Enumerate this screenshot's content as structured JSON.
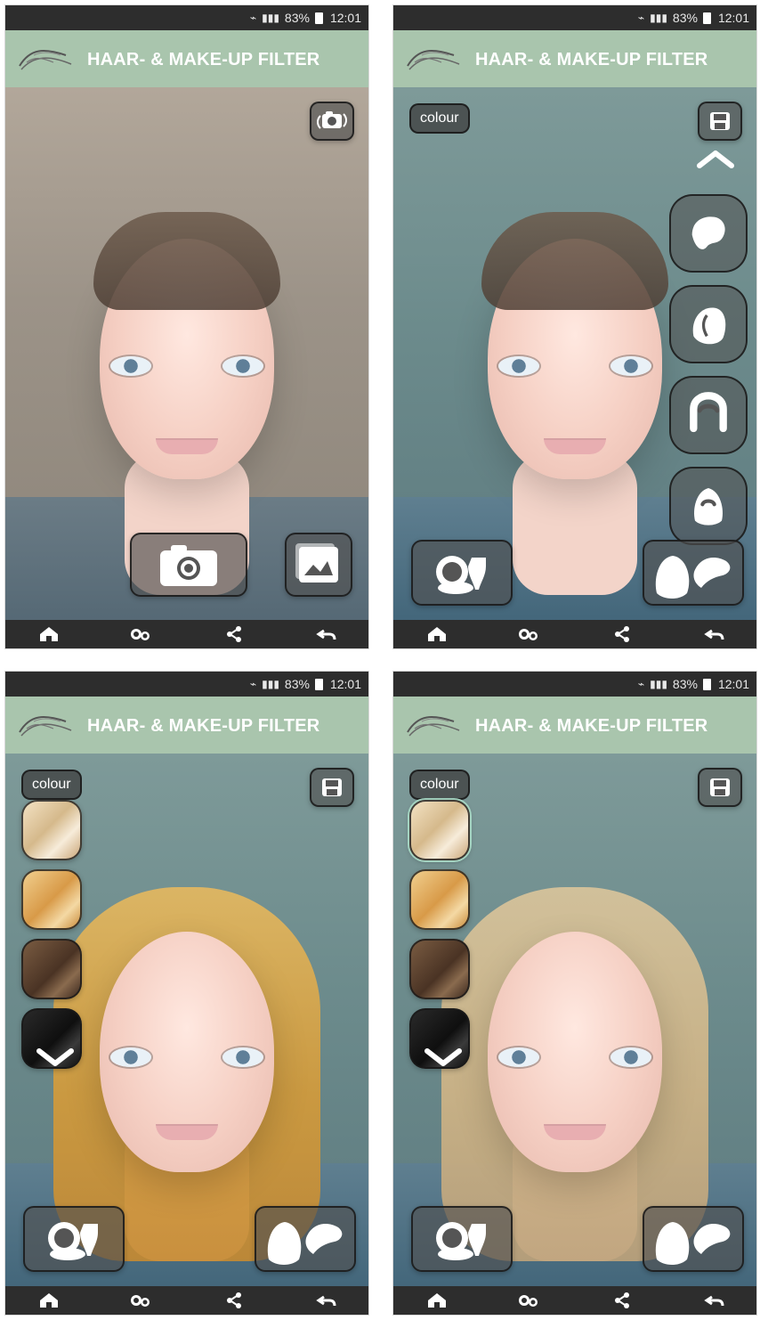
{
  "status_bar": {
    "battery": "83%",
    "time": "12:01"
  },
  "app": {
    "title": "HAAR- & MAKE-UP FILTER"
  },
  "labels": {
    "colour": "colour"
  },
  "icons": {
    "home": "home-icon",
    "settings": "settings-gears-icon",
    "share": "share-icon",
    "back": "back-icon",
    "camera": "camera-icon",
    "gallery": "gallery-icon",
    "switch_camera": "switch-camera-icon",
    "save": "save-icon",
    "makeup": "makeup-icon",
    "hair": "hair-icon"
  },
  "colors": {
    "header": "#a9c5ad",
    "status": "#2d2d2d",
    "nav": "#2d2d2d",
    "accent_light": "#ffffff"
  }
}
